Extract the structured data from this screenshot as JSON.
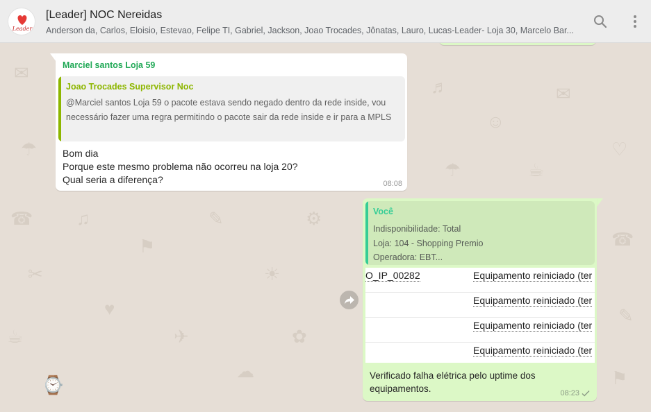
{
  "header": {
    "title": "[Leader] NOC Nereidas",
    "members": "Anderson da, Carlos, Eloisio, Estevao, Felipe TI, Gabriel, Jackson, Joao Trocades, Jônatas, Lauro, Lucas-Leader- Loja 30, Marcelo Bar...",
    "avatar_text": "Leader",
    "search_icon": "search-icon",
    "menu_icon": "kebab-menu-icon"
  },
  "incoming_message": {
    "sender": "Marciel santos Loja 59",
    "quote": {
      "author": "Joao Trocades Supervisor Noc",
      "text": "@Marciel santos Loja 59 o pacote estava sendo negado dentro da rede inside, vou necessário fazer uma regra permitindo o pacote sair da rede inside e ir para a MPLS"
    },
    "lines": [
      "Bom dia",
      "Porque este mesmo problema não ocorreu na loja 20?",
      "Qual seria a diferença?"
    ],
    "time": "08:08"
  },
  "outgoing_message": {
    "quote": {
      "author": "Você",
      "lines": [
        "Indisponibilidade: Total",
        "Loja: 104 - Shopping Premio",
        "Operadora: EBT..."
      ]
    },
    "image_rows": [
      {
        "id": "O_IP_00282",
        "status": "Equipamento reiniciado (ter"
      },
      {
        "id": "",
        "status": "Equipamento reiniciado (ter"
      },
      {
        "id": "",
        "status": "Equipamento reiniciado (ter"
      },
      {
        "id": "",
        "status": "Equipamento reiniciado (ter"
      }
    ],
    "text": "Verificado falha elétrica pelo uptime dos equipamentos.",
    "time": "08:23",
    "status_icon": "single-check-icon"
  },
  "colors": {
    "header_bg": "#ededed",
    "chat_bg": "#e6ded6",
    "incoming_bubble": "#ffffff",
    "outgoing_bubble": "#dcf8c6",
    "sender_name": "#1fa855",
    "quote_author_in": "#8db600",
    "quote_author_out": "#35cd96"
  }
}
